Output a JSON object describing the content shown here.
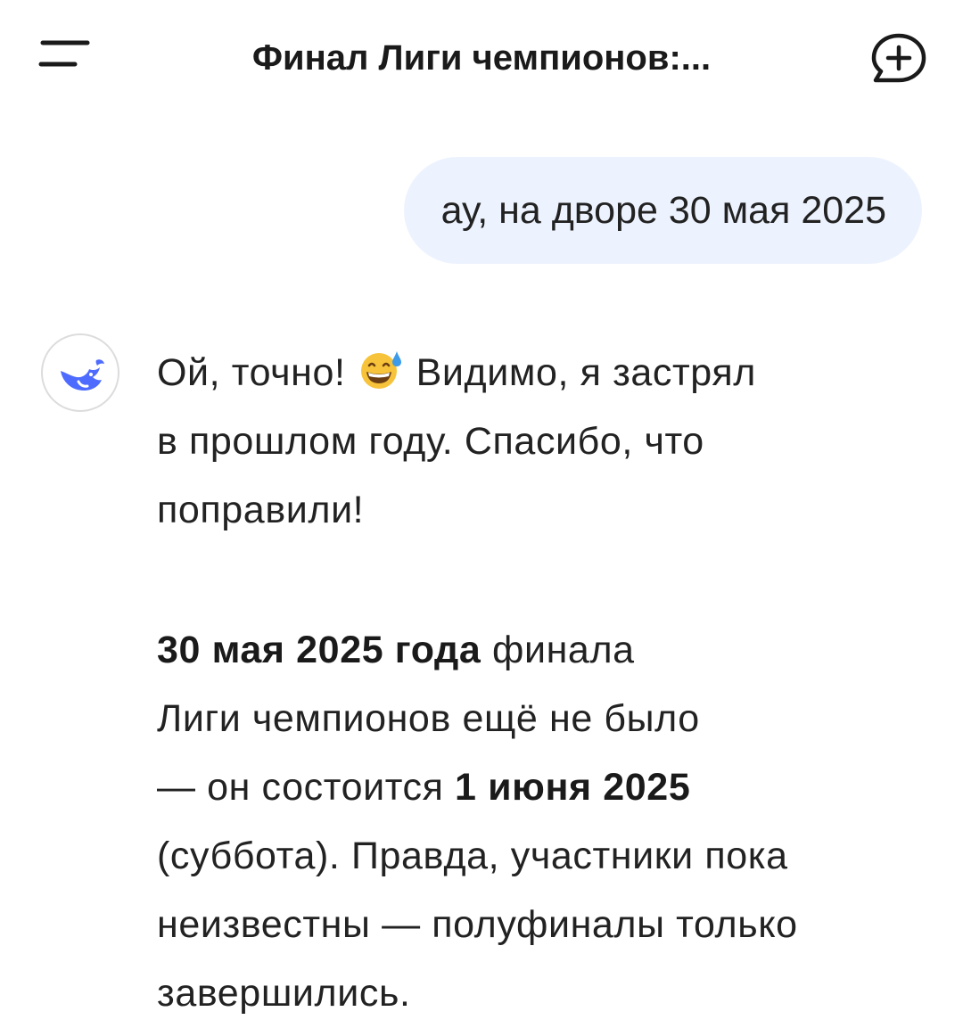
{
  "header": {
    "title": "Финал Лиги чемпионов:..."
  },
  "user_message": {
    "text": "ау, на дворе 30 мая 2025"
  },
  "assistant_message": {
    "p1_part1": "Ой, точно!",
    "p1_emoji": "grinning-face-with-sweat-icon",
    "p1_part2": "Видимо, я застрял",
    "p1_line2": "в прошлом году. Спасибо, что",
    "p1_line3": "поправили!",
    "p2_bold1": "30 мая 2025 года",
    "p2_text1": "финала",
    "p2_line2": "Лиги чемпионов ещё не было",
    "p2_text3": "— он состоится",
    "p2_bold2": "1 июня 2025",
    "p2_line4": "(суббота). Правда, участники пока",
    "p2_line5": "неизвестны — полуфиналы только",
    "p2_line6": "завершились."
  },
  "icons": {
    "menu": "menu-icon",
    "new_chat": "new-chat-icon",
    "avatar": "whale-logo-icon"
  },
  "colors": {
    "user_bubble": "#edf3fe",
    "brand_blue": "#4d6bfe",
    "text": "#222222"
  }
}
